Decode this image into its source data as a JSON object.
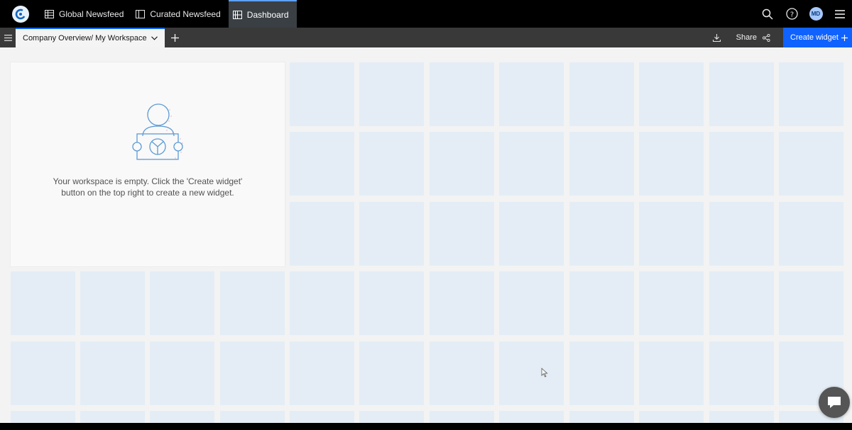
{
  "nav": {
    "tabs": [
      {
        "label": "Global Newsfeed",
        "icon": "table-icon"
      },
      {
        "label": "Curated Newsfeed",
        "icon": "panel-icon"
      },
      {
        "label": "Dashboard",
        "icon": "grid-icon",
        "active": true
      }
    ],
    "avatar_initials": "MD"
  },
  "toolbar": {
    "workspace_tab_label": "Company Overview/ My Workspace",
    "share_label": "Share",
    "create_widget_label": "Create widget"
  },
  "empty_state": {
    "message": "Your workspace is empty. Click the 'Create widget' button on the top right to create a new widget."
  },
  "colors": {
    "accent": "#0f62fe",
    "nav_bg": "#000000",
    "toolbar_bg": "#393939",
    "grid_cell": "#e4edf5"
  }
}
